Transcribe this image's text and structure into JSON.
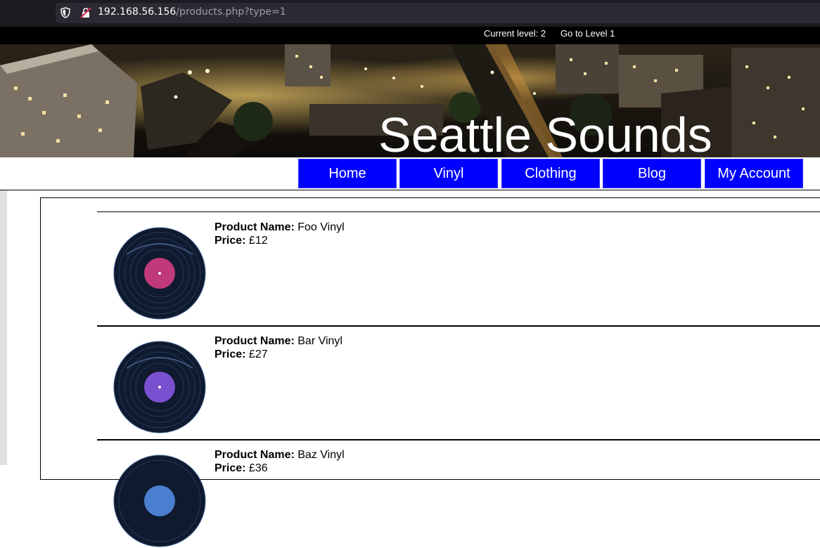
{
  "browser": {
    "url_host": "192.168.56.156",
    "url_path": "/products.php?type=1"
  },
  "levelbar": {
    "current_level": "Current level: 2",
    "goto_level": "Go to Level 1"
  },
  "site": {
    "title": "Seattle Sounds"
  },
  "nav": {
    "items": [
      "Home",
      "Vinyl",
      "Clothing",
      "Blog",
      "My Account"
    ],
    "color": "#0000ff"
  },
  "products": [
    {
      "name_label": "Product Name:",
      "name": "Foo Vinyl",
      "price_label": "Price:",
      "price": "£12",
      "label_color": "#c0397a"
    },
    {
      "name_label": "Product Name:",
      "name": "Bar Vinyl",
      "price_label": "Price:",
      "price": "£27",
      "label_color": "#7a4fd0"
    },
    {
      "name_label": "Product Name:",
      "name": "Baz Vinyl",
      "price_label": "Price:",
      "price": "£36",
      "label_color": "#4a7fd0"
    }
  ]
}
